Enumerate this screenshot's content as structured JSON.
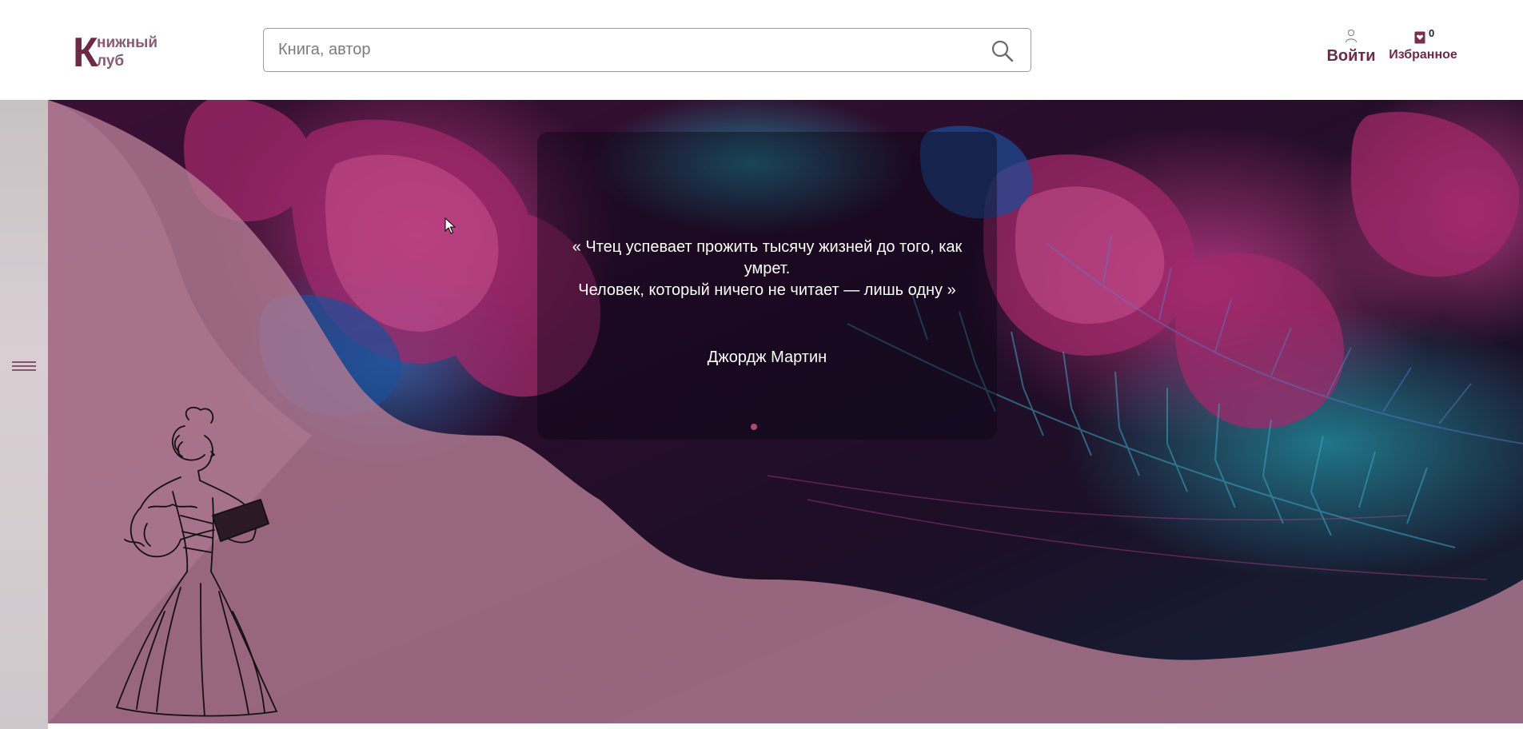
{
  "header": {
    "logo": {
      "letter_1": "К",
      "rest_1": "нижный",
      "rest_2": "луб"
    },
    "search": {
      "placeholder": "Книга, автор",
      "icon": "search-icon"
    },
    "login": {
      "label": "Войти",
      "icon": "user-icon"
    },
    "favorites": {
      "label": "Избранное",
      "count": "0",
      "icon": "heart-box-icon"
    }
  },
  "sidebar": {
    "menu_icon": "hamburger-menu-icon"
  },
  "hero": {
    "quote_line_1": "« Чтец успевает прожить тысячу жизней до того, как умрет.",
    "quote_line_2": "Человек, который ничего не читает — лишь одну »",
    "author": "Джордж Мартин",
    "slides_total": 1,
    "slide_active": 1
  },
  "colors": {
    "brand": "#6e2a45",
    "logo_secondary": "#8a5a71",
    "wave_overlay": "#b27a91",
    "slider_dot": "#b04a6c"
  }
}
